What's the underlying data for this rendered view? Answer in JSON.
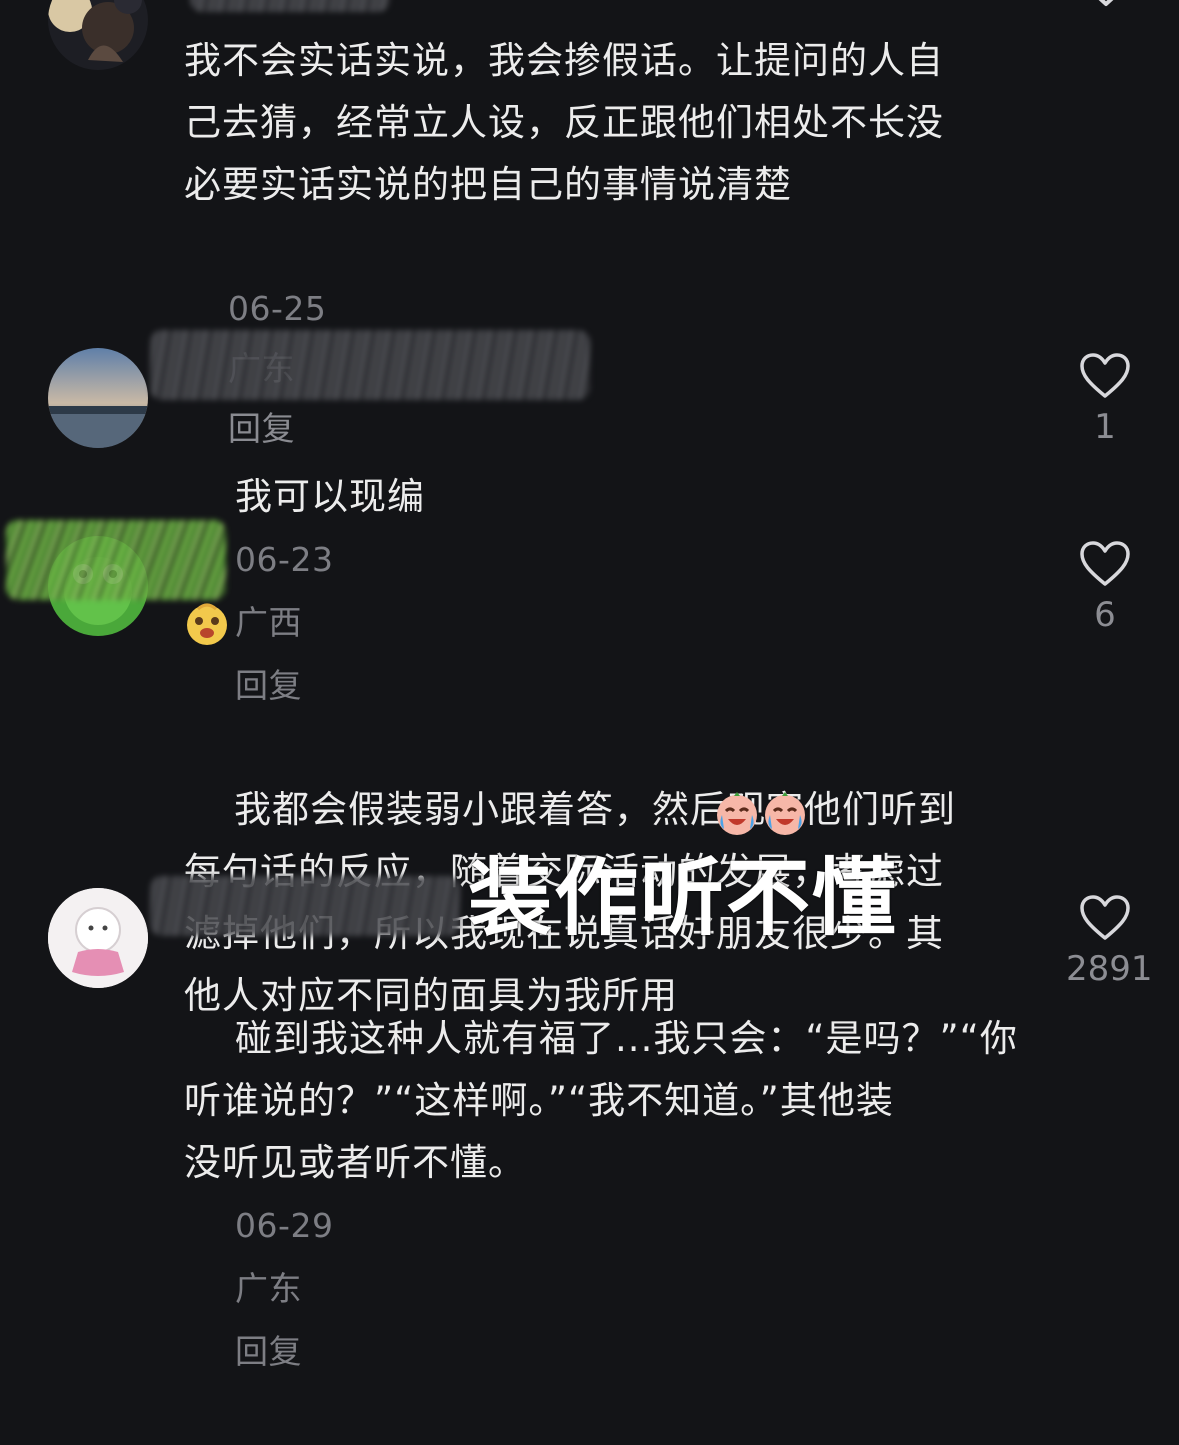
{
  "comments": [
    {
      "text": "我不会实话实说，我会掺假话。让提问的人自\n己去猜，经常立人设，反正跟他们相处不长没\n必要实话实说的把自己的事情说清楚",
      "date": "06-25",
      "location": "广东",
      "reply": "回复"
    },
    {
      "text": "我可以现编",
      "date": "06-23",
      "location": "广西",
      "reply": "回复",
      "likes": "1"
    },
    {
      "text": "我都会假装弱小跟着答，然后观察他们听到\n每句话的反应，随着交际活动的发展，考虑过\n滤掉他们，所以我现在说真话好朋友很少。其\n他人对应不同的面具为我所用",
      "likes": "6"
    },
    {
      "text": "碰到我这种人就有福了...我只会：“是吗？”“你\n听谁说的？”“这样啊。”“我不知道。”其他装\n没听见或者听不懂。",
      "date": "06-29",
      "location": "广东",
      "reply": "回复",
      "likes": "2891"
    }
  ],
  "overlay_caption": "装作听不懂",
  "icons": {
    "like": "heart-outline-icon",
    "emoji_face": "happy-face-emoji-icon",
    "emoji_cry": "laugh-cry-emoji-icon"
  },
  "colors": {
    "background": "#131417",
    "text": "#ececec",
    "meta": "#7d7e84",
    "like_icon": "#d8d8dc"
  }
}
